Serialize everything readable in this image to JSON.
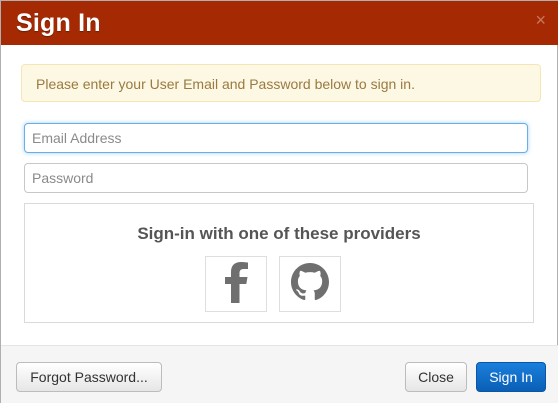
{
  "header": {
    "title": "Sign In",
    "close_glyph": "×",
    "color": "#a52a04"
  },
  "alert": {
    "text": "Please enter your User Email and Password below to sign in."
  },
  "form": {
    "email_placeholder": "Email Address",
    "email_value": "",
    "password_placeholder": "Password",
    "password_value": ""
  },
  "providers": {
    "heading": "Sign-in with one of these providers",
    "items": [
      {
        "name": "facebook",
        "icon": "facebook-icon"
      },
      {
        "name": "github",
        "icon": "github-icon"
      }
    ]
  },
  "footer": {
    "forgot_label": "Forgot Password...",
    "close_label": "Close",
    "signin_label": "Sign In"
  }
}
